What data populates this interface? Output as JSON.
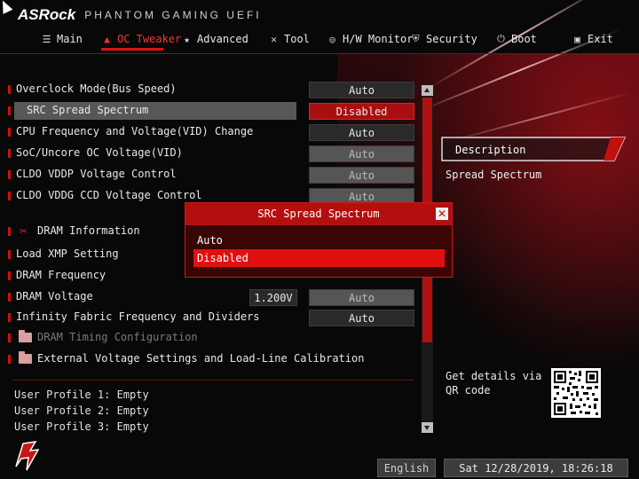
{
  "header": {
    "brand": "ASRock",
    "subtitle": "PHANTOM GAMING UEFI"
  },
  "nav": {
    "items": [
      {
        "label": "Main",
        "icon": "list-icon"
      },
      {
        "label": "OC Tweaker",
        "icon": "flame-icon",
        "active": true
      },
      {
        "label": "Advanced",
        "icon": "star-icon"
      },
      {
        "label": "Tool",
        "icon": "wrench-icon"
      },
      {
        "label": "H/W Monitor",
        "icon": "monitor-icon"
      },
      {
        "label": "Security",
        "icon": "shield-icon"
      },
      {
        "label": "Boot",
        "icon": "power-icon"
      },
      {
        "label": "Exit",
        "icon": "exit-icon"
      }
    ]
  },
  "settings": {
    "overclock_mode": {
      "label": "Overclock Mode(Bus Speed)",
      "value": "Auto"
    },
    "src_spread": {
      "label": "SRC Spread Spectrum",
      "value": "Disabled"
    },
    "cpu_freq": {
      "label": "CPU Frequency and Voltage(VID) Change",
      "value": "Auto"
    },
    "soc_uncore": {
      "label": "SoC/Uncore OC Voltage(VID)",
      "value": "Auto"
    },
    "cldo_vddp": {
      "label": "CLDO VDDP Voltage Control",
      "value": "Auto"
    },
    "cldo_vddg": {
      "label": "CLDO VDDG CCD Voltage Control",
      "value": "Auto"
    },
    "dram_info": {
      "label": "DRAM Information"
    },
    "load_xmp": {
      "label": "Load XMP Setting"
    },
    "dram_freq": {
      "label": "DRAM Frequency"
    },
    "dram_voltage": {
      "label": "DRAM Voltage",
      "voltage": "1.200V",
      "value": "Auto"
    },
    "infinity_fabric": {
      "label": "Infinity Fabric Frequency and Dividers",
      "value": "Auto"
    },
    "dram_timing": {
      "label": "DRAM Timing Configuration"
    },
    "ext_voltage": {
      "label": "External Voltage Settings and Load-Line Calibration"
    }
  },
  "profiles": [
    "User Profile 1: Empty",
    "User Profile 2: Empty",
    "User Profile 3: Empty"
  ],
  "description": {
    "title": "Description",
    "text": "Spread Spectrum",
    "qr_text": "Get details via QR code"
  },
  "modal": {
    "title": "SRC Spread Spectrum",
    "options": [
      "Auto",
      "Disabled"
    ],
    "selected": "Disabled"
  },
  "footer": {
    "language": "English",
    "datetime": "Sat 12/28/2019, 18:26:18"
  },
  "colors": {
    "accent": "#e01010",
    "selected_option": "#e01010",
    "background": "#080808"
  }
}
